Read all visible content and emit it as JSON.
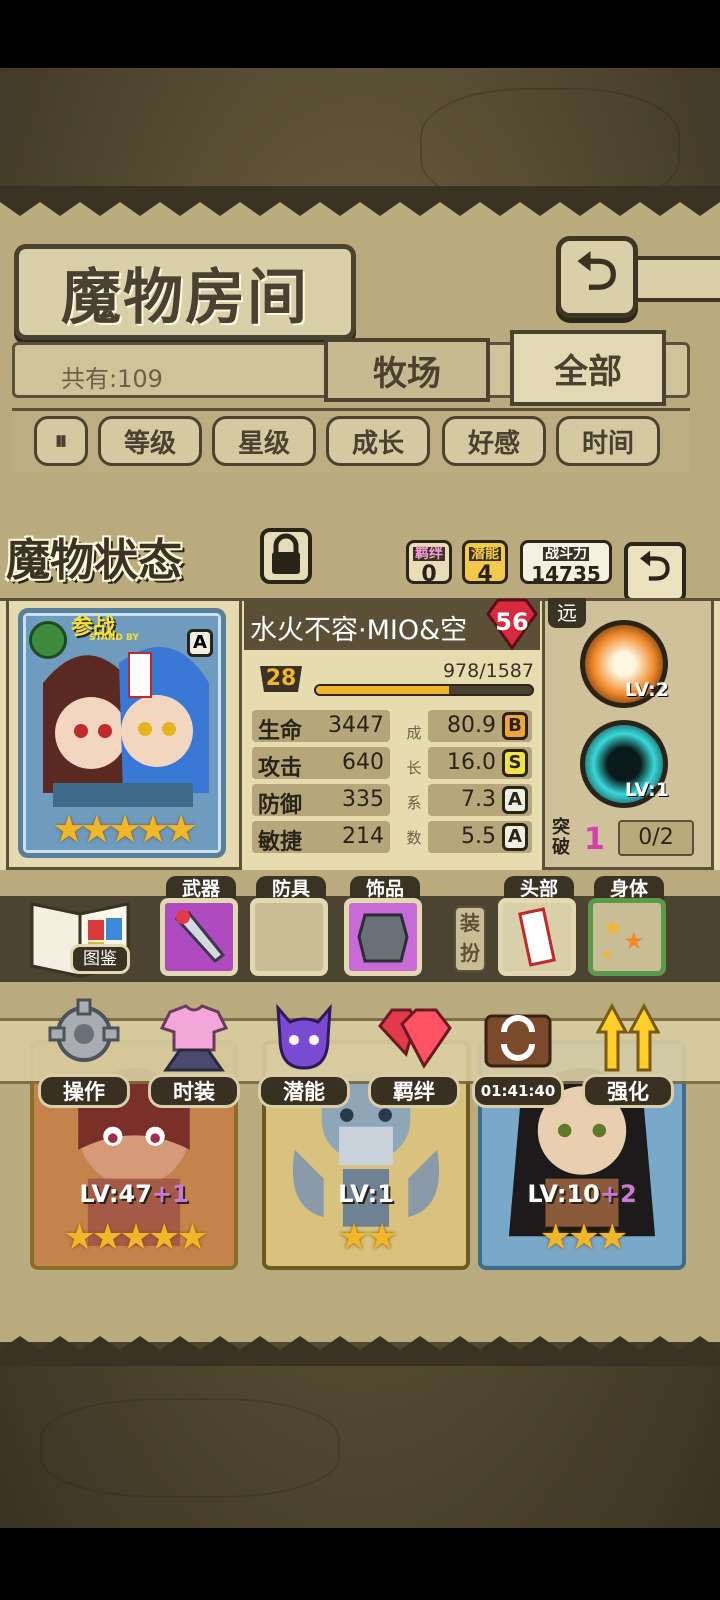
{
  "header": {
    "title": "魔物房间",
    "back_icon": "undo-arrow-icon"
  },
  "collection": {
    "total_label": "共有:109",
    "tabs": [
      {
        "label": "牧场"
      },
      {
        "label": "全部"
      }
    ]
  },
  "filters": [
    "等级",
    "星级",
    "成长",
    "好感",
    "时间"
  ],
  "status": {
    "title": "魔物状态",
    "bond_label": "羁绊",
    "bond_value": "0",
    "potential_label": "潜能",
    "potential_value": "4",
    "power_label": "战斗力",
    "power_value": "14735",
    "card_badge": "参战",
    "card_badge_sub": "STAND BY",
    "card_grade": "A",
    "stars": "★★★★★",
    "name": "水火不容·MIO&空",
    "level": "56",
    "exp_level": "28",
    "exp_text": "978/1587",
    "exp_fraction": 0.616,
    "stats": [
      {
        "name": "生命",
        "value": "3447",
        "growth": "80.9",
        "grade": "B"
      },
      {
        "name": "攻击",
        "value": "640",
        "growth": "16.0",
        "grade": "S"
      },
      {
        "name": "防御",
        "value": "335",
        "growth": "7.3",
        "grade": "A"
      },
      {
        "name": "敏捷",
        "value": "214",
        "growth": "5.5",
        "grade": "A"
      }
    ],
    "growth_label": [
      "成",
      "长",
      "系",
      "数"
    ],
    "range": "远",
    "skills": [
      {
        "lv": "LV:2"
      },
      {
        "lv": "LV:1"
      }
    ],
    "break_label": "突破",
    "break_value": "1",
    "break_progress": "0/2"
  },
  "equipment": {
    "book_label": "图鉴",
    "weapon": "武器",
    "armor": "防具",
    "accessory": "饰品",
    "dress_label": "装扮",
    "head": "头部",
    "body": "身体"
  },
  "actions": [
    {
      "label": "操作"
    },
    {
      "label": "时装"
    },
    {
      "label": "潜能"
    },
    {
      "label": "羁绊"
    },
    {
      "label": "01:41:40"
    },
    {
      "label": "强化"
    }
  ],
  "cards": [
    {
      "lv": "LV:47",
      "plus": "+1",
      "stars": "★★★★★"
    },
    {
      "lv": "LV:1",
      "plus": "",
      "stars": "★★"
    },
    {
      "lv": "LV:10",
      "plus": "+2",
      "stars": "★★★"
    }
  ]
}
